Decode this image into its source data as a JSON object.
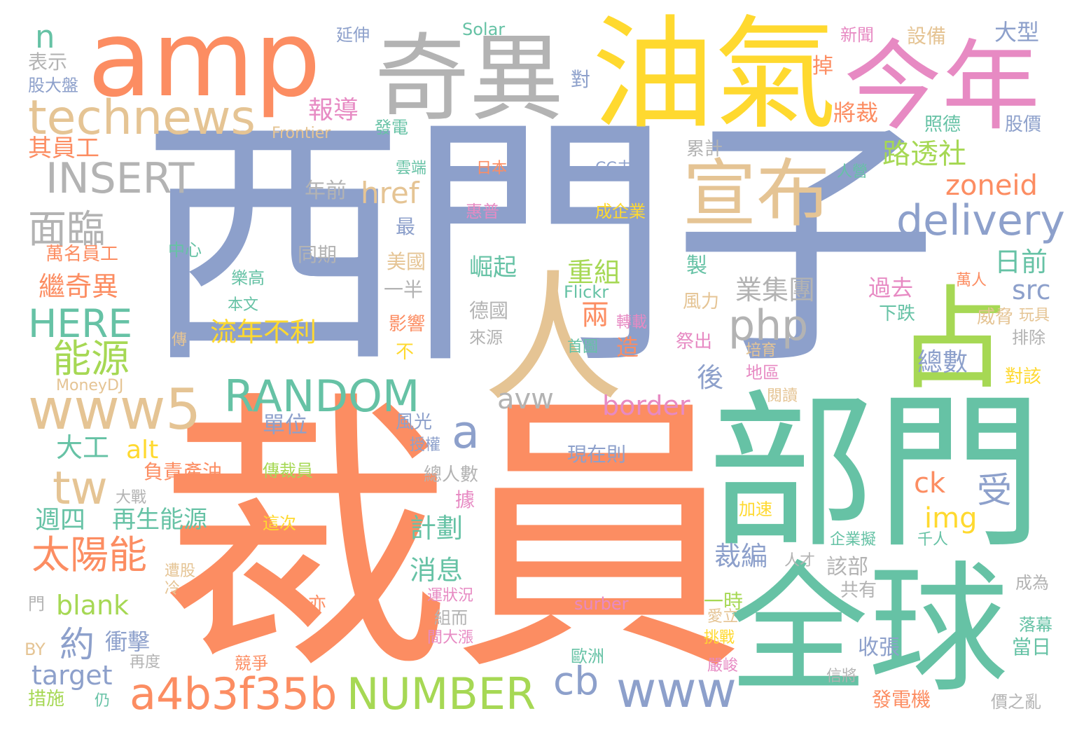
{
  "words": [
    {
      "text": "西門子",
      "color": "#8da0cb"
    },
    {
      "text": "裁員",
      "color": "#fc8d62"
    },
    {
      "text": "部門",
      "color": "#66c2a5"
    },
    {
      "text": "全球",
      "color": "#66c2a5"
    },
    {
      "text": "油氣",
      "color": "#ffd92f"
    },
    {
      "text": "amp",
      "color": "#fc8d62"
    },
    {
      "text": "奇異",
      "color": "#b3b3b3"
    },
    {
      "text": "今年",
      "color": "#e78ac3"
    },
    {
      "text": "人",
      "color": "#e5c494"
    },
    {
      "text": "占",
      "color": "#a6d854"
    },
    {
      "text": "宣布",
      "color": "#e5c494"
    },
    {
      "text": "technews",
      "color": "#e5c494"
    },
    {
      "text": "INSERT",
      "color": "#b3b3b3"
    },
    {
      "text": "www5",
      "color": "#e5c494"
    },
    {
      "text": "RANDOM",
      "color": "#66c2a5"
    },
    {
      "text": "NUMBER",
      "color": "#a6d854"
    },
    {
      "text": "a4b3f35b",
      "color": "#fc8d62"
    },
    {
      "text": "www",
      "color": "#8da0cb"
    },
    {
      "text": "delivery",
      "color": "#8da0cb"
    },
    {
      "text": "php",
      "color": "#b3b3b3"
    },
    {
      "text": "zoneid",
      "color": "#fc8d62"
    },
    {
      "text": "HERE",
      "color": "#66c2a5"
    },
    {
      "text": "能源",
      "color": "#a6d854"
    },
    {
      "text": "太陽能",
      "color": "#fc8d62"
    },
    {
      "text": "面臨",
      "color": "#b3b3b3"
    },
    {
      "text": "tw",
      "color": "#e5c494"
    },
    {
      "text": "a",
      "color": "#8da0cb"
    },
    {
      "text": "路透社",
      "color": "#a6d854"
    },
    {
      "text": "日前",
      "color": "#66c2a5"
    },
    {
      "text": "src",
      "color": "#8da0cb"
    },
    {
      "text": "href",
      "color": "#e5c494"
    },
    {
      "text": "border",
      "color": "#e78ac3"
    },
    {
      "text": "avw",
      "color": "#b3b3b3"
    },
    {
      "text": "cb",
      "color": "#8da0cb"
    },
    {
      "text": "img",
      "color": "#ffd92f"
    },
    {
      "text": "ck",
      "color": "#fc8d62"
    },
    {
      "text": "受",
      "color": "#8da0cb"
    },
    {
      "text": "blank",
      "color": "#a6d854"
    },
    {
      "text": "target",
      "color": "#8da0cb"
    },
    {
      "text": "約",
      "color": "#8da0cb"
    },
    {
      "text": "alt",
      "color": "#ffd92f"
    },
    {
      "text": "n",
      "color": "#66c2a5"
    },
    {
      "text": "重組",
      "color": "#a6d854"
    },
    {
      "text": "業集團",
      "color": "#b3b3b3"
    },
    {
      "text": "繼奇異",
      "color": "#fc8d62"
    },
    {
      "text": "流年不利",
      "color": "#ffd92f"
    },
    {
      "text": "報導",
      "color": "#e78ac3"
    },
    {
      "text": "大型",
      "color": "#8da0cb"
    },
    {
      "text": "將裁",
      "color": "#fc8d62"
    },
    {
      "text": "其員工",
      "color": "#fc8d62"
    },
    {
      "text": "週四",
      "color": "#66c2a5"
    },
    {
      "text": "再生能源",
      "color": "#66c2a5"
    },
    {
      "text": "大工",
      "color": "#66c2a5"
    },
    {
      "text": "計劃",
      "color": "#66c2a5"
    },
    {
      "text": "消息",
      "color": "#66c2a5"
    },
    {
      "text": "總數",
      "color": "#8da0cb"
    },
    {
      "text": "裁編",
      "color": "#8da0cb"
    },
    {
      "text": "崛起",
      "color": "#66c2a5"
    },
    {
      "text": "兩",
      "color": "#fc8d62"
    },
    {
      "text": "後",
      "color": "#8da0cb"
    },
    {
      "text": "單位",
      "color": "#8da0cb"
    },
    {
      "text": "衝擊",
      "color": "#8da0cb"
    },
    {
      "text": "過去",
      "color": "#e78ac3"
    },
    {
      "text": "該部",
      "color": "#b3b3b3"
    },
    {
      "text": "收張",
      "color": "#8da0cb"
    },
    {
      "text": "當日",
      "color": "#66c2a5"
    },
    {
      "text": "年前",
      "color": "#b3b3b3"
    },
    {
      "text": "表示",
      "color": "#b3b3b3"
    },
    {
      "text": "股大盤",
      "color": "#8da0cb"
    },
    {
      "text": "延伸",
      "color": "#8da0cb"
    },
    {
      "text": "Solar",
      "color": "#66c2a5"
    },
    {
      "text": "新聞",
      "color": "#e78ac3"
    },
    {
      "text": "設備",
      "color": "#e5c494"
    },
    {
      "text": "掉",
      "color": "#fc8d62"
    },
    {
      "text": "對",
      "color": "#8da0cb"
    },
    {
      "text": "發電",
      "color": "#66c2a5"
    },
    {
      "text": "Frontier",
      "color": "#e5c494"
    },
    {
      "text": "照德",
      "color": "#66c2a5"
    },
    {
      "text": "股價",
      "color": "#8da0cb"
    },
    {
      "text": "累計",
      "color": "#b3b3b3"
    },
    {
      "text": "雲端",
      "color": "#66c2a5"
    },
    {
      "text": "日本",
      "color": "#fc8d62"
    },
    {
      "text": "CC未",
      "color": "#8da0cb"
    },
    {
      "text": "人營",
      "color": "#66c2a5"
    },
    {
      "text": "惠普",
      "color": "#e78ac3"
    },
    {
      "text": "成企業",
      "color": "#ffd92f"
    },
    {
      "text": "中心",
      "color": "#66c2a5"
    },
    {
      "text": "樂高",
      "color": "#66c2a5"
    },
    {
      "text": "本文",
      "color": "#66c2a5"
    },
    {
      "text": "同期",
      "color": "#b3b3b3"
    },
    {
      "text": "最",
      "color": "#8da0cb"
    },
    {
      "text": "美國",
      "color": "#e5c494"
    },
    {
      "text": "一半",
      "color": "#b3b3b3"
    },
    {
      "text": "德國",
      "color": "#b3b3b3"
    },
    {
      "text": "萬名員工",
      "color": "#fc8d62"
    },
    {
      "text": "影響",
      "color": "#fc8d62"
    },
    {
      "text": "來源",
      "color": "#b3b3b3"
    },
    {
      "text": "首圖",
      "color": "#66c2a5"
    },
    {
      "text": "轉載",
      "color": "#e78ac3"
    },
    {
      "text": "造",
      "color": "#fc8d62"
    },
    {
      "text": "製",
      "color": "#66c2a5"
    },
    {
      "text": "Flickr",
      "color": "#66c2a5"
    },
    {
      "text": "風力",
      "color": "#e5c494"
    },
    {
      "text": "祭出",
      "color": "#e78ac3"
    },
    {
      "text": "培育",
      "color": "#e5c494"
    },
    {
      "text": "地區",
      "color": "#e78ac3"
    },
    {
      "text": "閱讀",
      "color": "#e5c494"
    },
    {
      "text": "萬人",
      "color": "#fc8d62"
    },
    {
      "text": "下跌",
      "color": "#66c2a5"
    },
    {
      "text": "玩具",
      "color": "#e5c494"
    },
    {
      "text": "威脅",
      "color": "#e5c494"
    },
    {
      "text": "排除",
      "color": "#b3b3b3"
    },
    {
      "text": "對該",
      "color": "#ffd92f"
    },
    {
      "text": "傳",
      "color": "#e5c494"
    },
    {
      "text": "不",
      "color": "#ffd92f"
    },
    {
      "text": "MoneyDJ",
      "color": "#e5c494"
    },
    {
      "text": "風光",
      "color": "#8da0cb"
    },
    {
      "text": "授權",
      "color": "#8da0cb"
    },
    {
      "text": "現在則",
      "color": "#8da0cb"
    },
    {
      "text": "負責產油",
      "color": "#fc8d62"
    },
    {
      "text": "傳裁員",
      "color": "#a6d854"
    },
    {
      "text": "總人數",
      "color": "#b3b3b3"
    },
    {
      "text": "大戰",
      "color": "#b3b3b3"
    },
    {
      "text": "據",
      "color": "#e78ac3"
    },
    {
      "text": "加速",
      "color": "#ffd92f"
    },
    {
      "text": "這次",
      "color": "#ffd92f"
    },
    {
      "text": "企業擬",
      "color": "#66c2a5"
    },
    {
      "text": "千人",
      "color": "#66c2a5"
    },
    {
      "text": "人才",
      "color": "#b3b3b3"
    },
    {
      "text": "遭股",
      "color": "#e5c494"
    },
    {
      "text": "冷",
      "color": "#e5c494"
    },
    {
      "text": "共有",
      "color": "#b3b3b3"
    },
    {
      "text": "成為",
      "color": "#b3b3b3"
    },
    {
      "text": "運狀況",
      "color": "#e78ac3"
    },
    {
      "text": "surber",
      "color": "#e78ac3"
    },
    {
      "text": "亦",
      "color": "#fc8d62"
    },
    {
      "text": "門",
      "color": "#b3b3b3"
    },
    {
      "text": "一時",
      "color": "#a6d854"
    },
    {
      "text": "組而",
      "color": "#b3b3b3"
    },
    {
      "text": "愛立",
      "color": "#e5c494"
    },
    {
      "text": "落幕",
      "color": "#66c2a5"
    },
    {
      "text": "BY",
      "color": "#e5c494"
    },
    {
      "text": "挑戰",
      "color": "#ffd92f"
    },
    {
      "text": "間大漲",
      "color": "#e78ac3"
    },
    {
      "text": "歐洲",
      "color": "#66c2a5"
    },
    {
      "text": "再度",
      "color": "#b3b3b3"
    },
    {
      "text": "競爭",
      "color": "#fc8d62"
    },
    {
      "text": "嚴峻",
      "color": "#e78ac3"
    },
    {
      "text": "信將",
      "color": "#b3b3b3"
    },
    {
      "text": "措施",
      "color": "#a6d854"
    },
    {
      "text": "仍",
      "color": "#66c2a5"
    },
    {
      "text": "發電機",
      "color": "#fc8d62"
    },
    {
      "text": "價之亂",
      "color": "#b3b3b3"
    }
  ]
}
